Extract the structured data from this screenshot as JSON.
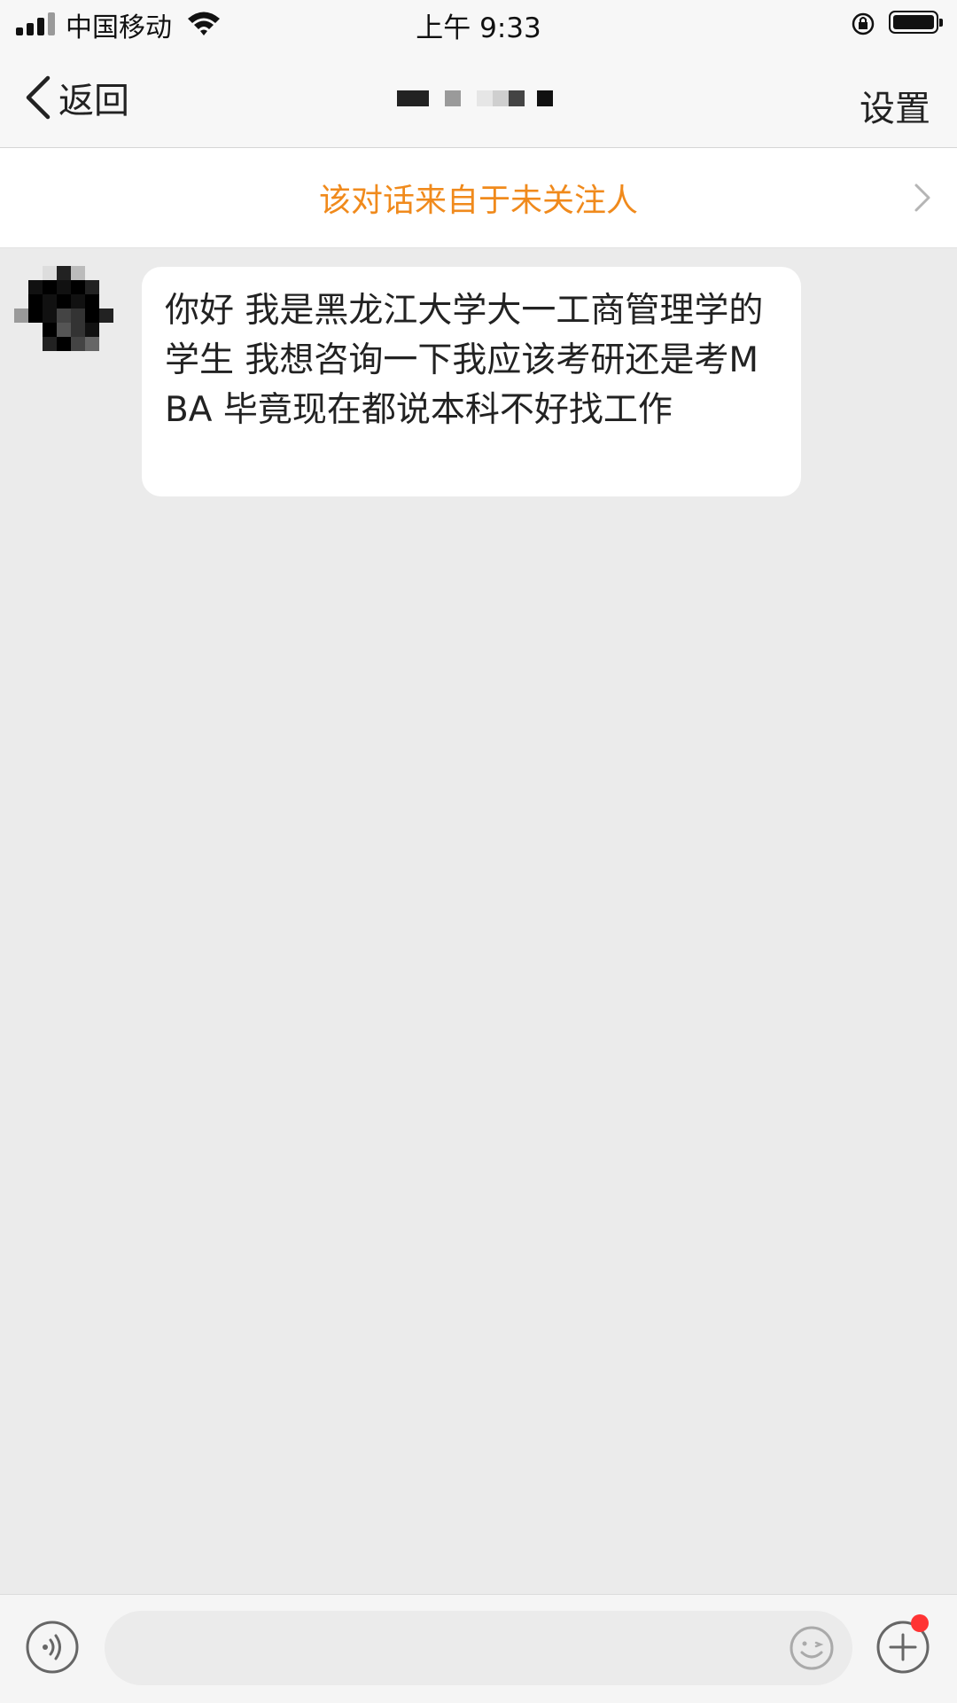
{
  "status_bar": {
    "carrier": "中国移动",
    "time": "上午 9:33",
    "icons": [
      "signal-icon",
      "wifi-icon",
      "rotation-lock-icon",
      "battery-icon"
    ]
  },
  "nav": {
    "back_label": "返回",
    "title": "",
    "settings_label": "设置"
  },
  "notice": {
    "text": "该对话来自于未关注人",
    "icon": "chevron-right-icon"
  },
  "messages": [
    {
      "sender": "other",
      "text": "你好 我是黑龙江大学大一工商管理学的学生 我想咨询一下我应该考研还是考MBA 毕竟现在都说本科不好找工作"
    }
  ],
  "input_bar": {
    "placeholder": "",
    "icons": [
      "voice-icon",
      "emoji-icon",
      "plus-icon"
    ],
    "badge_color": "#ff3333"
  },
  "colors": {
    "accent": "#f08a1c",
    "background": "#ebebeb",
    "bubble": "#ffffff"
  }
}
